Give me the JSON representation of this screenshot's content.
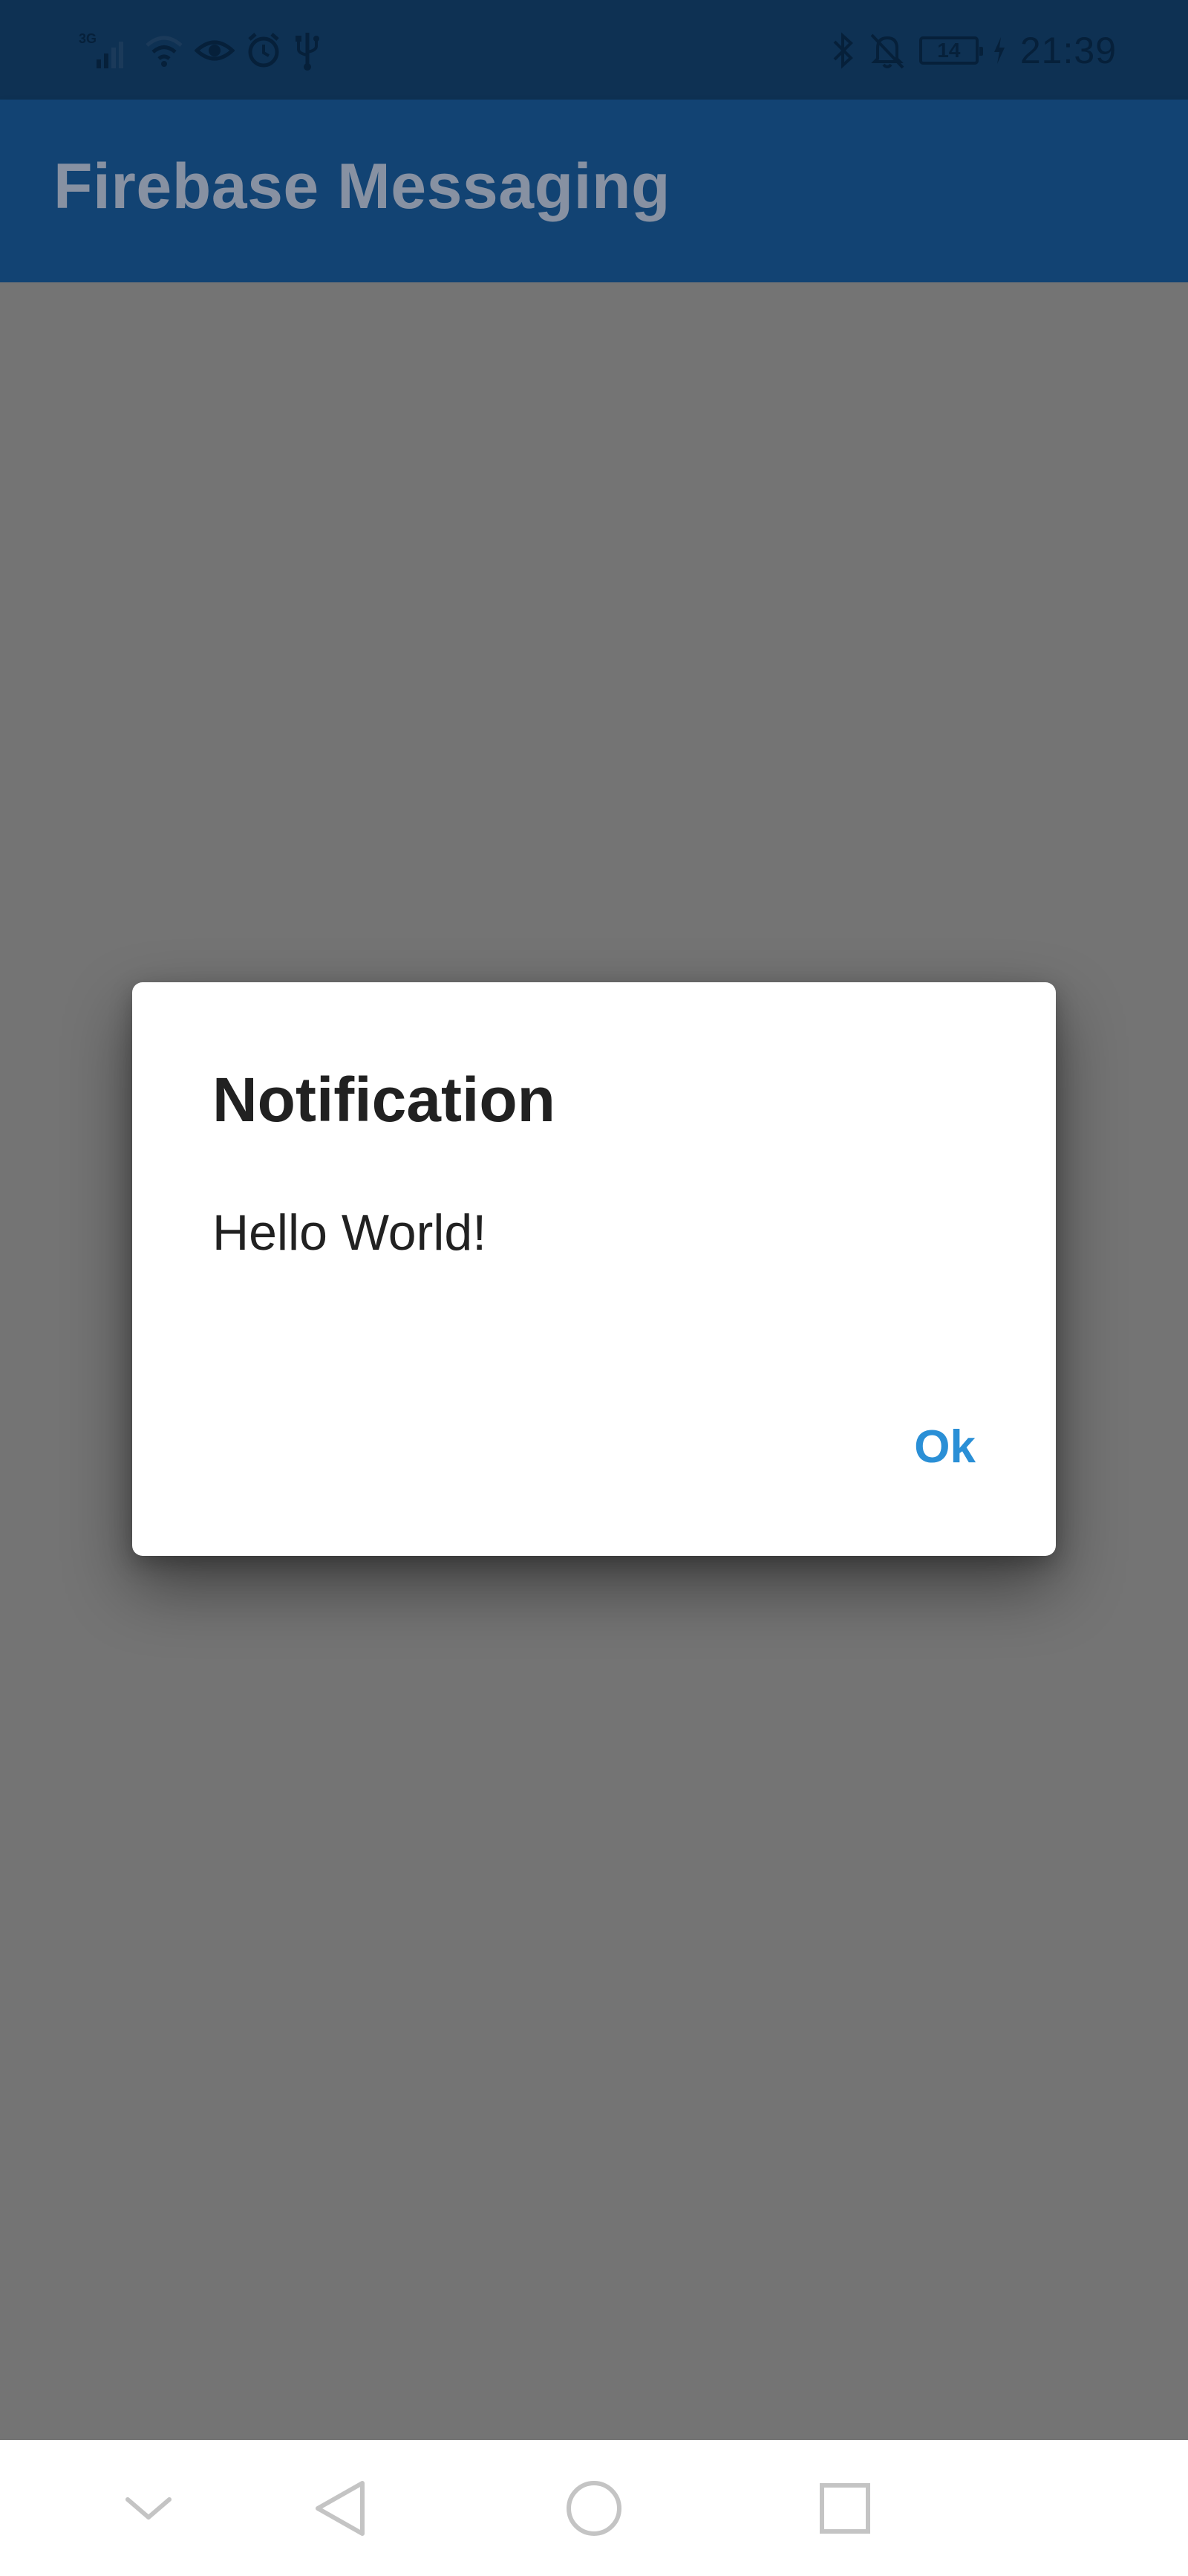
{
  "status_bar": {
    "network_type": "3G",
    "battery_level": "14",
    "time": "21:39",
    "icons_left": [
      "signal-icon",
      "wifi-icon",
      "eye-icon",
      "alarm-icon",
      "usb-icon"
    ],
    "icons_right": [
      "bluetooth-icon",
      "notifications-off-icon",
      "battery-icon",
      "charging-icon"
    ]
  },
  "app_bar": {
    "title": "Firebase Messaging"
  },
  "dialog": {
    "title": "Notification",
    "message": "Hello World!",
    "ok_label": "Ok"
  },
  "nav_bar": {
    "buttons": [
      "hide-keyboard-icon",
      "back-icon",
      "home-icon",
      "recents-icon"
    ]
  },
  "colors": {
    "status_bar_bg": "#0e3153",
    "app_bar_bg": "#124373",
    "app_bar_title": "#8791a2",
    "scrim": "#747474",
    "dialog_bg": "#ffffff",
    "accent": "#2a8fd6",
    "text_primary": "#212121",
    "nav_icon": "#c4c4c4"
  }
}
